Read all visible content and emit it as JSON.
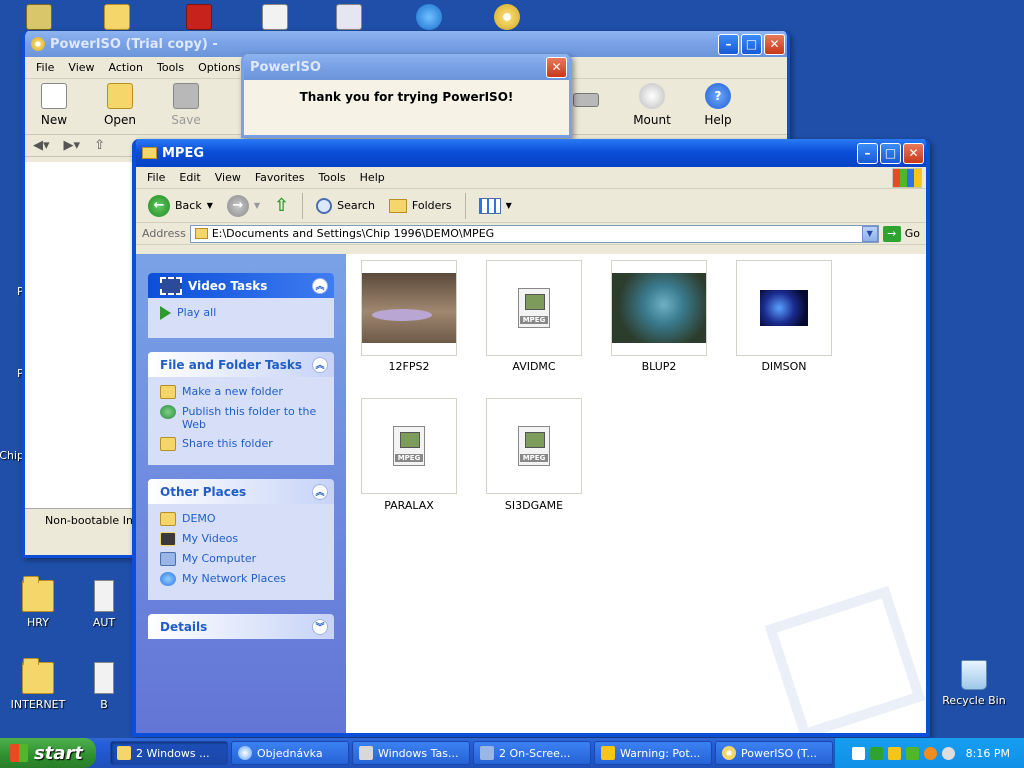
{
  "desktop": {
    "icons": [
      {
        "label": "HRY"
      },
      {
        "label": "AUT"
      },
      {
        "label": "INTERNET"
      },
      {
        "label": "B"
      },
      {
        "label": "Recycle Bin"
      }
    ],
    "partial_labels": [
      "Po",
      "Po",
      "Chip"
    ]
  },
  "poweriso": {
    "title": "PowerISO (Trial copy) -",
    "menu": [
      "File",
      "View",
      "Action",
      "Tools",
      "Options"
    ],
    "toolbar": [
      {
        "label": "New"
      },
      {
        "label": "Open"
      },
      {
        "label": "Save"
      },
      {
        "label": "Mount"
      },
      {
        "label": "Help"
      }
    ],
    "status": "Non-bootable Ima"
  },
  "nag": {
    "title": "PowerISO",
    "message": "Thank you for trying PowerISO!"
  },
  "explorer": {
    "title": "MPEG",
    "menu": [
      "File",
      "Edit",
      "View",
      "Favorites",
      "Tools",
      "Help"
    ],
    "toolbar": {
      "back": "Back",
      "search": "Search",
      "folders": "Folders"
    },
    "address": {
      "label": "Address",
      "path": "E:\\Documents and Settings\\Chip 1996\\DEMO\\MPEG",
      "go": "Go"
    },
    "panels": {
      "video_tasks": {
        "title": "Video Tasks",
        "items": [
          "Play all"
        ]
      },
      "file_folder": {
        "title": "File and Folder Tasks",
        "items": [
          "Make a new folder",
          "Publish this folder to the Web",
          "Share this folder"
        ]
      },
      "other_places": {
        "title": "Other Places",
        "items": [
          "DEMO",
          "My Videos",
          "My Computer",
          "My Network Places"
        ]
      },
      "details": {
        "title": "Details"
      }
    },
    "files": [
      "12FPS2",
      "AVIDMC",
      "BLUP2",
      "DIMSON",
      "PARALAX",
      "SI3DGAME"
    ]
  },
  "taskbar": {
    "start": "start",
    "tasks": [
      "2 Windows ...",
      "Objednávka",
      "Windows Tas...",
      "2 On-Scree...",
      "Warning: Pot...",
      "PowerISO (T..."
    ],
    "clock": "8:16 PM"
  }
}
